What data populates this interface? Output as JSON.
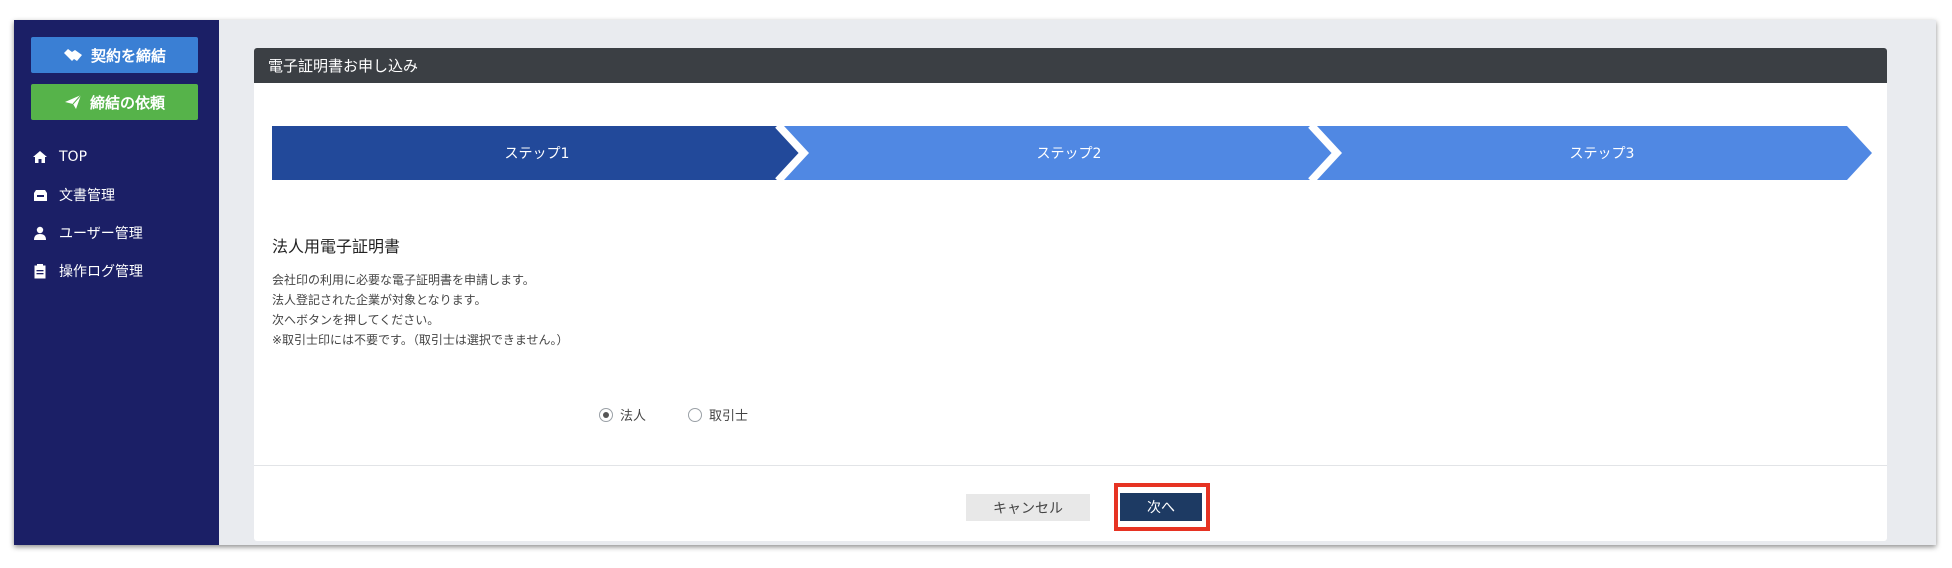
{
  "sidebar": {
    "contract_button": "契約を締結",
    "request_button": "締結の依頼",
    "nav": [
      {
        "label": "TOP",
        "icon": "home-icon"
      },
      {
        "label": "文書管理",
        "icon": "inbox-icon"
      },
      {
        "label": "ユーザー管理",
        "icon": "user-icon"
      },
      {
        "label": "操作ログ管理",
        "icon": "clipboard-icon"
      }
    ]
  },
  "card": {
    "header": "電子証明書お申し込み",
    "steps": [
      "ステップ1",
      "ステップ2",
      "ステップ3"
    ],
    "active_step": 1,
    "title": "法人用電子証明書",
    "description": [
      "会社印の利用に必要な電子証明書を申請します。",
      "法人登記された企業が対象となります。",
      "次へボタンを押してください。",
      "※取引士印には不要です。（取引士は選択できません。）"
    ],
    "radios": {
      "option1": "法人",
      "option2": "取引士",
      "selected": "法人"
    },
    "cancel_button": "キャンセル",
    "next_button": "次へ"
  },
  "colors": {
    "sidebar_bg": "#1b1f66",
    "contract_btn": "#3a7fd4",
    "request_btn": "#56b34a",
    "step_active": "#22499a",
    "step_inactive": "#5088e3",
    "header_bg": "#3b3f44",
    "next_btn": "#1d3a63",
    "highlight": "#e63323"
  }
}
